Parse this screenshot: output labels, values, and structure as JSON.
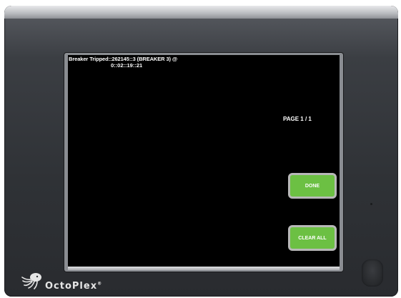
{
  "screen": {
    "message_line1": "Breaker Tripped::262145::3 (BREAKER 3) @",
    "message_line2": "0::02::19::21",
    "page_indicator": "PAGE 1 / 1"
  },
  "buttons": {
    "done_label": "DONE",
    "clear_all_label": "CLEAR ALL"
  },
  "brand": {
    "logo_text": "OctoPlex",
    "logo_mark": "®",
    "icon": "octopus-icon"
  },
  "colors": {
    "button_fill": "#6cc043",
    "button_border": "#b8b8b8",
    "screen_background": "#000000",
    "bezel": "#2f3236"
  }
}
